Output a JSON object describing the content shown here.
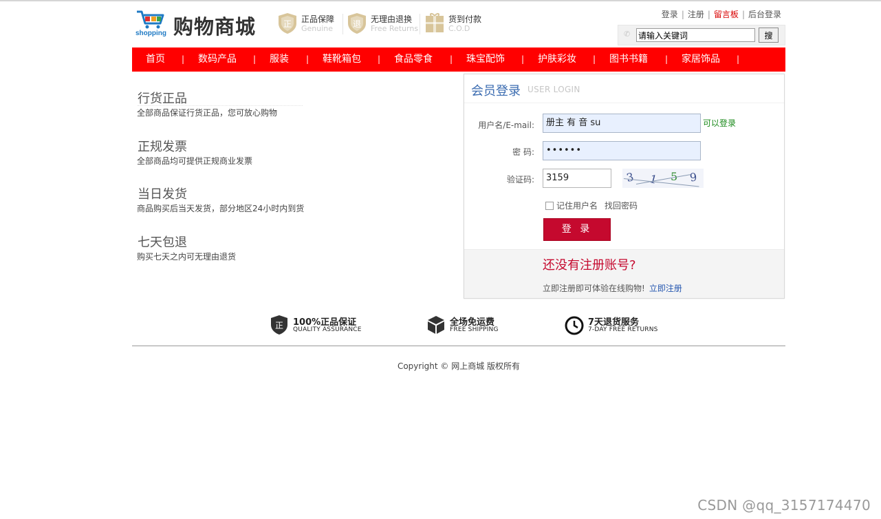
{
  "header": {
    "logo_text": "购物商城",
    "logo_sub": "shopping",
    "badges": [
      {
        "title": "正品保障",
        "sub": "Genuine",
        "icon": "shield-zheng-icon"
      },
      {
        "title": "无理由退换",
        "sub": "Free Returns",
        "icon": "shield-tui-icon"
      },
      {
        "title": "货到付款",
        "sub": "C.O.D",
        "icon": "gift-box-icon"
      }
    ],
    "top_links": {
      "login": "登录",
      "register": "注册",
      "guestbook": "留言板",
      "admin": "后台登录",
      "separator": "|"
    },
    "search": {
      "value": "请输入关键词",
      "button": "搜"
    }
  },
  "nav": {
    "items": [
      "首页",
      "数码产品",
      "服装",
      "鞋靴箱包",
      "食品零食",
      "珠宝配饰",
      "护肤彩妆",
      "图书书籍",
      "家居饰品"
    ],
    "separator": "|"
  },
  "features": [
    {
      "title": "行货正品",
      "desc": "全部商品保证行货正品，您可放心购物"
    },
    {
      "title": "正规发票",
      "desc": "全部商品均可提供正规商业发票"
    },
    {
      "title": "当日发货",
      "desc": "商品购买后当天发货，部分地区24小时内到货"
    },
    {
      "title": "七天包退",
      "desc": "购买七天之内可无理由退货"
    }
  ],
  "login": {
    "title": "会员登录",
    "title_en": "USER LOGIN",
    "username_label": "用户名/E-mail:",
    "username_value": "册主 有 音 su",
    "username_status": "可以登录",
    "password_label": "密  码:",
    "password_value": "••••••",
    "captcha_label": "验证码:",
    "captcha_value": "3159",
    "captcha_image": [
      "3",
      "1",
      "5",
      "9"
    ],
    "remember_label": "记住用户名",
    "forgot_label": "找回密码",
    "submit_label": "登 录",
    "register_question": "还没有注册账号?",
    "register_text": "立即注册即可体验在线购物!",
    "register_link": "立即注册"
  },
  "services": [
    {
      "title": "100%正品保证",
      "sub": "QUALITY ASSURANCE",
      "icon": "shield-zheng-icon"
    },
    {
      "title": "全场免运费",
      "sub": "FREE SHIPPING",
      "icon": "box-icon"
    },
    {
      "title": "7天退货服务",
      "sub": "7-DAY FREE RETURNS",
      "icon": "clock-icon"
    }
  ],
  "footer": {
    "copyright": "Copyright © 网上商城 版权所有"
  },
  "watermark": "CSDN @qq_3157174470",
  "colors": {
    "nav": "#ff0000",
    "login_button": "#c5092e",
    "link_blue": "#2657b0",
    "ok_green": "#1b8a1b"
  }
}
